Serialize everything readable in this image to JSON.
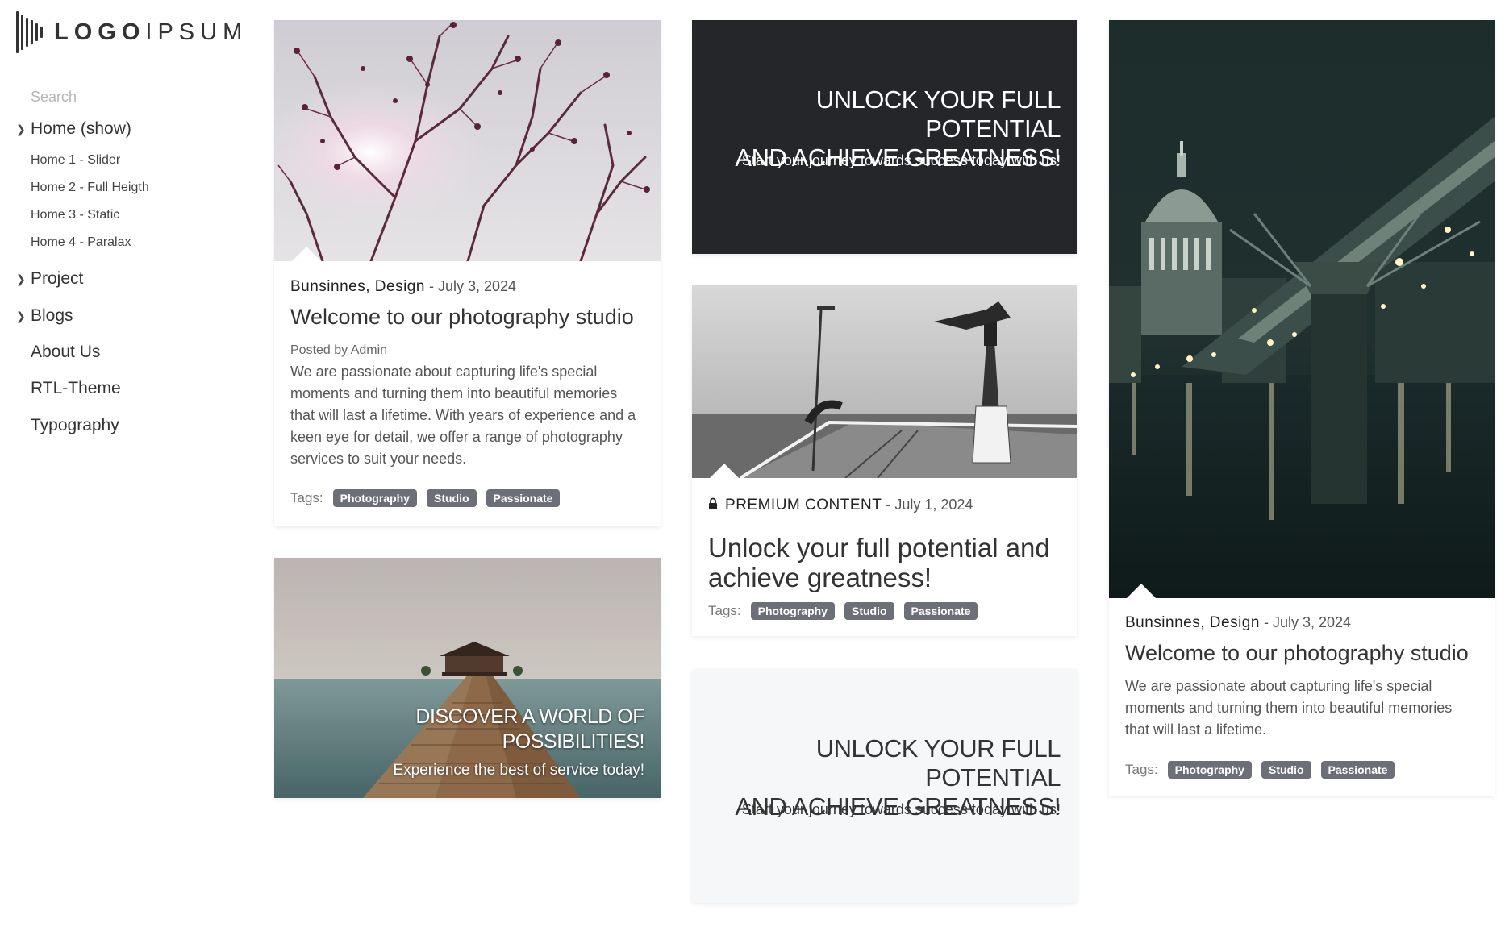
{
  "logo": {
    "text_bold": "LOGO",
    "text_light": "IPSUM"
  },
  "search": {
    "placeholder": "Search"
  },
  "nav": {
    "home": "Home (show)",
    "home_items": [
      "Home 1 - Slider",
      "Home 2 - Full Heigth",
      "Home 3 - Static",
      "Home 4 - Paralax"
    ],
    "project": "Project",
    "blogs": "Blogs",
    "about": "About Us",
    "rtl": "RTL-Theme",
    "typography": "Typography"
  },
  "card1": {
    "category": "Bunsinnes, Design",
    "date": "- July 3, 2024",
    "title": "Welcome to our photography studio",
    "posted": "Posted by Admin",
    "body": "We are passionate about capturing life's special moments and turning them into beautiful memories that will last a lifetime. With years of experience and a keen eye for detail, we offer a range of photography services to suit your needs.",
    "tags_label": "Tags:",
    "tags": [
      "Photography",
      "Studio",
      "Passionate"
    ]
  },
  "card2": {
    "title": "DISCOVER A WORLD OF POSSIBILITIES!",
    "subtitle": "Experience the best of service today!"
  },
  "promo_dark": {
    "title_line1": "UNLOCK YOUR FULL POTENTIAL",
    "title_line2": "AND ACHIEVE GREATNESS!",
    "subtitle": "Start your journey towards success today with us!"
  },
  "card_premium": {
    "lock_icon": "lock-icon",
    "category": "PREMIUM CONTENT",
    "date": "- July 1, 2024",
    "title": "Unlock your full potential and achieve greatness!",
    "tags_label": "Tags:",
    "tags": [
      "Photography",
      "Studio",
      "Passionate"
    ]
  },
  "promo_light": {
    "title_line1": "UNLOCK YOUR FULL POTENTIAL",
    "title_line2": "AND ACHIEVE GREATNESS!",
    "subtitle": "Start your journey towards success today with us!"
  },
  "card_city": {
    "category": "Bunsinnes, Design",
    "date": "- July 3, 2024",
    "title": "Welcome to our photography studio",
    "body": "We are passionate about capturing life's special moments and turning them into beautiful memories that will last a lifetime.",
    "tags_label": "Tags:",
    "tags": [
      "Photography",
      "Studio",
      "Passionate"
    ]
  },
  "colors": {
    "dark_panel": "#24262a",
    "light_panel": "#f6f7f8",
    "tag_bg": "#6c6f78"
  }
}
